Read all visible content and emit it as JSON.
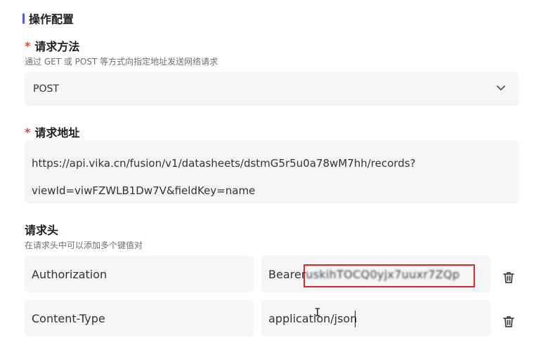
{
  "section": {
    "title": "操作配置"
  },
  "method": {
    "label": "请求方法",
    "hint": "通过 GET 或 POST 等方式向指定地址发送网络请求",
    "selected": "POST"
  },
  "url": {
    "label": "请求地址",
    "lines": [
      "https://api.vika.cn/fusion/v1/datasheets/dstmG5r5u0a78wM7hh/records?",
      "viewId=viwFZWLB1Dw7V&fieldKey=name"
    ]
  },
  "headers": {
    "label": "请求头",
    "hint": "在请求头中可以添加多个键值对",
    "rows": [
      {
        "key": "Authorization",
        "value_prefix": "Bearer",
        "value_masked": " uskihTOCQ0yjx7uuxr7ZQp"
      },
      {
        "key": "Content-Type",
        "value": "application/json"
      }
    ]
  },
  "colors": {
    "accent": "#5b57d6",
    "required": "#e0473a",
    "highlight": "#e02828",
    "field_bg": "#f4f5f7"
  },
  "icons": {
    "select": "chevron-down-icon",
    "delete": "trash-icon"
  }
}
